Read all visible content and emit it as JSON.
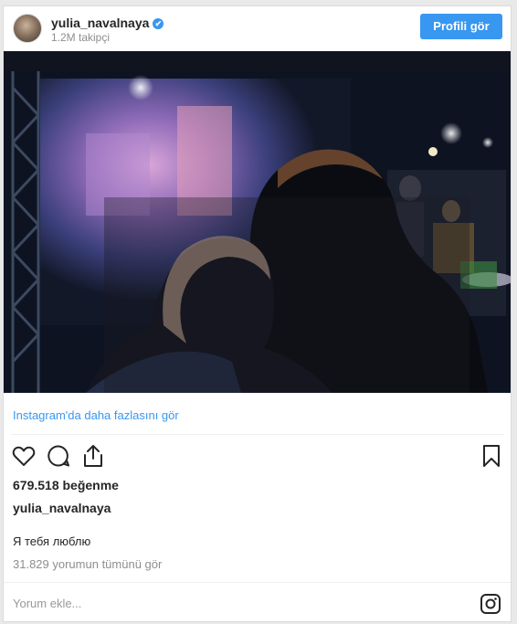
{
  "header": {
    "username": "yulia_navalnaya",
    "verified_mark": "✔",
    "followers": "1.2M takipçi",
    "profile_button": "Profili gör"
  },
  "post": {
    "see_more": "Instagram'da daha fazlasını gör",
    "likes": "679.518 beğenme",
    "caption_user": "yulia_navalnaya",
    "caption_text": "Я тебя люблю",
    "view_comments": "31.829 yorumun tümünü gör",
    "add_comment_placeholder": "Yorum ekle..."
  },
  "icons": {
    "like": "heart-icon",
    "comment": "comment-icon",
    "share": "share-icon",
    "save": "bookmark-icon",
    "instagram": "instagram-icon"
  },
  "colors": {
    "accent": "#3897f0",
    "text": "#262626",
    "muted": "#8e8e8e"
  }
}
